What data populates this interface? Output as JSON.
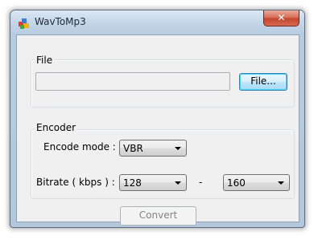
{
  "window": {
    "title": "WavToMp3",
    "close_glyph": "✕"
  },
  "file_group": {
    "label": "File",
    "path_value": "",
    "browse_label": "File..."
  },
  "encoder_group": {
    "label": "Encoder",
    "mode_label": "Encode mode :",
    "mode_value": "VBR",
    "bitrate_label": "Bitrate ( kbps ) :",
    "bitrate_min_value": "128",
    "separator": "-",
    "bitrate_max_value": "160"
  },
  "actions": {
    "convert_label": "Convert"
  },
  "colors": {
    "title_bar": "#c4d6e8",
    "close_button": "#c4452e",
    "client_background": "#f0f0f0"
  }
}
